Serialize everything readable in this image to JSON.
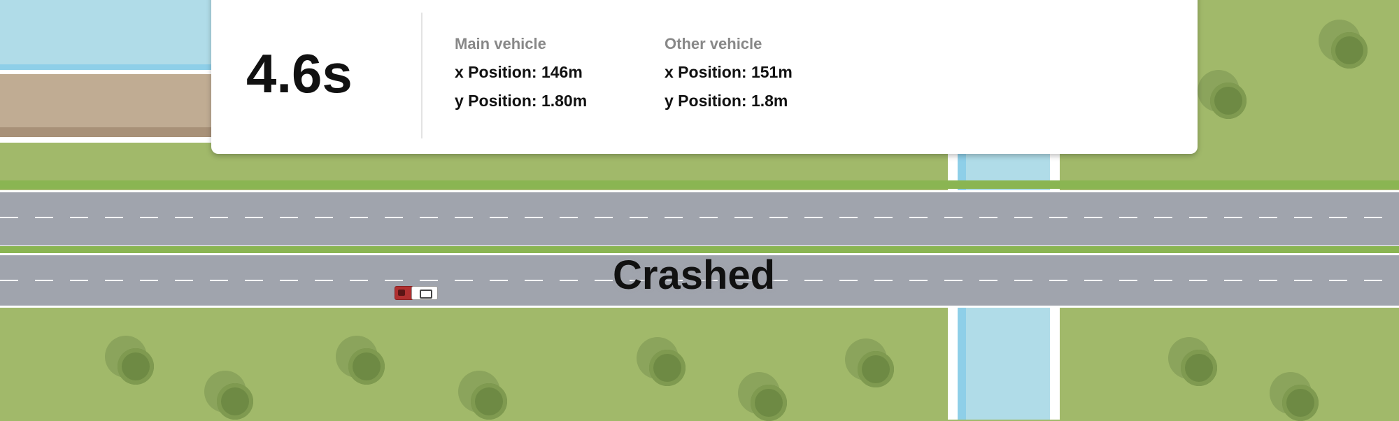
{
  "hud": {
    "time": "4.6s",
    "main_vehicle": {
      "title": "Main vehicle",
      "x": "x Position: 146m",
      "y": "y Position: 1.80m"
    },
    "other_vehicle": {
      "title": "Other vehicle",
      "x": "x Position: 151m",
      "y": "y Position: 1.8m"
    }
  },
  "status": "Crashed",
  "colors": {
    "grass": "#a1b96a",
    "road": "#a0a4ad",
    "water": "#b0dce8",
    "main_vehicle": "#b03030",
    "other_vehicle": "#ffffff"
  }
}
